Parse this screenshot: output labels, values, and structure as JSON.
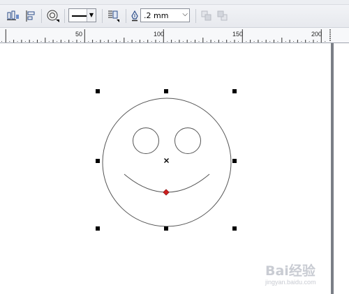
{
  "toolbar": {
    "icons": [
      "align-icon",
      "distribute-icon",
      "outline-pen-icon",
      "wrap-text-icon",
      "pen-nib-icon",
      "to-front-icon",
      "to-back-icon"
    ],
    "line_style": "solid",
    "outline_width": ".2 mm"
  },
  "ruler": {
    "labels": [
      "50",
      "100",
      "150",
      "200"
    ]
  },
  "canvas": {
    "selected_shape": "smiley-face",
    "node_color": "#cc1f1f"
  },
  "watermark": {
    "brand": "Bai经验",
    "url": "jingyan.baidu.com"
  }
}
